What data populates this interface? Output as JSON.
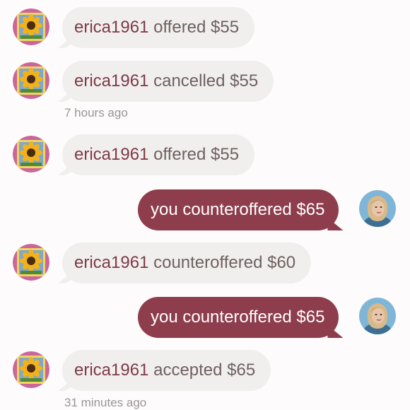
{
  "colors": {
    "background": "#fdfbfc",
    "incoming_bubble": "#f1efed",
    "incoming_text": "#6e6160",
    "username": "#7d3a47",
    "outgoing_bubble": "#8e3d4c",
    "outgoing_text": "#ffffff",
    "timestamp": "#9b9594"
  },
  "messages": [
    {
      "from": "other",
      "user": "erica1961",
      "action": "offered $55",
      "avatar_icon": "sunflower-icon"
    },
    {
      "from": "other",
      "user": "erica1961",
      "action": "cancelled $55",
      "avatar_icon": "sunflower-icon"
    },
    {
      "timestamp": "7 hours ago"
    },
    {
      "from": "other",
      "user": "erica1961",
      "action": "offered $55",
      "avatar_icon": "sunflower-icon"
    },
    {
      "from": "me",
      "text": "you counteroffered $65",
      "avatar_icon": "user-photo-icon"
    },
    {
      "from": "other",
      "user": "erica1961",
      "action": "counteroffered $60",
      "avatar_icon": "sunflower-icon"
    },
    {
      "from": "me",
      "text": "you counteroffered $65",
      "avatar_icon": "user-photo-icon"
    },
    {
      "from": "other",
      "user": "erica1961",
      "action": "accepted $65",
      "avatar_icon": "sunflower-icon"
    },
    {
      "timestamp": "31 minutes ago"
    }
  ]
}
